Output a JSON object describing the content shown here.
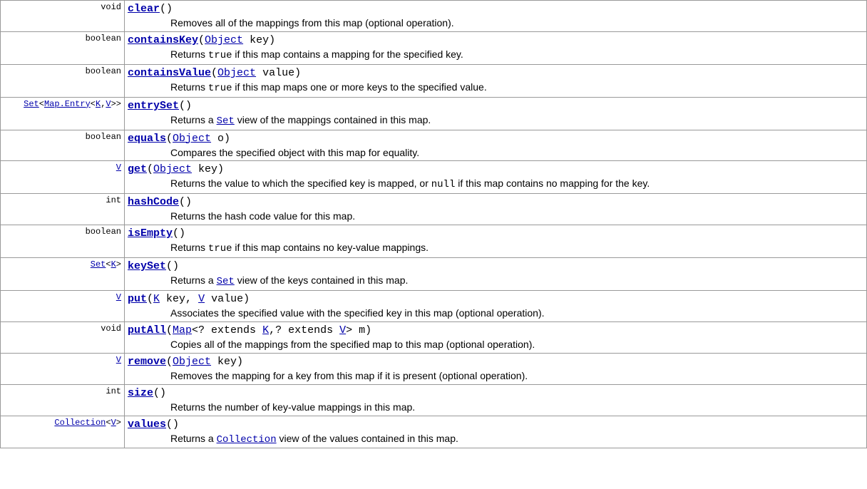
{
  "methods": [
    {
      "returnType": {
        "parts": [
          {
            "t": "void",
            "link": false
          }
        ]
      },
      "name": "clear",
      "sig": [
        {
          "t": "()",
          "link": false
        }
      ],
      "desc": [
        {
          "t": "Removes all of the mappings from this map (optional operation)."
        }
      ]
    },
    {
      "returnType": {
        "parts": [
          {
            "t": "boolean",
            "link": false
          }
        ]
      },
      "name": "containsKey",
      "sig": [
        {
          "t": "(",
          "link": false
        },
        {
          "t": "Object",
          "link": true
        },
        {
          "t": " key)",
          "link": false
        }
      ],
      "desc": [
        {
          "t": "Returns "
        },
        {
          "t": "true",
          "code": true
        },
        {
          "t": " if this map contains a mapping for the specified key."
        }
      ]
    },
    {
      "returnType": {
        "parts": [
          {
            "t": "boolean",
            "link": false
          }
        ]
      },
      "name": "containsValue",
      "sig": [
        {
          "t": "(",
          "link": false
        },
        {
          "t": "Object",
          "link": true
        },
        {
          "t": " value)",
          "link": false
        }
      ],
      "desc": [
        {
          "t": "Returns "
        },
        {
          "t": "true",
          "code": true
        },
        {
          "t": " if this map maps one or more keys to the specified value."
        }
      ]
    },
    {
      "returnType": {
        "parts": [
          {
            "t": "Set",
            "link": true
          },
          {
            "t": "<",
            "link": false
          },
          {
            "t": "Map.Entry",
            "link": true
          },
          {
            "t": "<",
            "link": false
          },
          {
            "t": "K",
            "link": true
          },
          {
            "t": ",",
            "link": false
          },
          {
            "t": "V",
            "link": true
          },
          {
            "t": ">>",
            "link": false
          }
        ]
      },
      "name": "entrySet",
      "sig": [
        {
          "t": "()",
          "link": false
        }
      ],
      "desc": [
        {
          "t": "Returns a "
        },
        {
          "t": "Set",
          "codeLink": true
        },
        {
          "t": " view of the mappings contained in this map."
        }
      ]
    },
    {
      "returnType": {
        "parts": [
          {
            "t": "boolean",
            "link": false
          }
        ]
      },
      "name": "equals",
      "sig": [
        {
          "t": "(",
          "link": false
        },
        {
          "t": "Object",
          "link": true
        },
        {
          "t": " o)",
          "link": false
        }
      ],
      "desc": [
        {
          "t": "Compares the specified object with this map for equality."
        }
      ]
    },
    {
      "returnType": {
        "parts": [
          {
            "t": "V",
            "link": true
          }
        ]
      },
      "name": "get",
      "sig": [
        {
          "t": "(",
          "link": false
        },
        {
          "t": "Object",
          "link": true
        },
        {
          "t": " key)",
          "link": false
        }
      ],
      "desc": [
        {
          "t": "Returns the value to which the specified key is mapped, or "
        },
        {
          "t": "null",
          "code": true
        },
        {
          "t": " if this map contains no mapping for the key."
        }
      ]
    },
    {
      "returnType": {
        "parts": [
          {
            "t": "int",
            "link": false
          }
        ]
      },
      "name": "hashCode",
      "sig": [
        {
          "t": "()",
          "link": false
        }
      ],
      "desc": [
        {
          "t": "Returns the hash code value for this map."
        }
      ]
    },
    {
      "returnType": {
        "parts": [
          {
            "t": "boolean",
            "link": false
          }
        ]
      },
      "name": "isEmpty",
      "sig": [
        {
          "t": "()",
          "link": false
        }
      ],
      "desc": [
        {
          "t": "Returns "
        },
        {
          "t": "true",
          "code": true
        },
        {
          "t": " if this map contains no key-value mappings."
        }
      ]
    },
    {
      "returnType": {
        "parts": [
          {
            "t": "Set",
            "link": true
          },
          {
            "t": "<",
            "link": false
          },
          {
            "t": "K",
            "link": true
          },
          {
            "t": ">",
            "link": false
          }
        ]
      },
      "name": "keySet",
      "sig": [
        {
          "t": "()",
          "link": false
        }
      ],
      "desc": [
        {
          "t": "Returns a "
        },
        {
          "t": "Set",
          "codeLink": true
        },
        {
          "t": " view of the keys contained in this map."
        }
      ]
    },
    {
      "returnType": {
        "parts": [
          {
            "t": "V",
            "link": true
          }
        ]
      },
      "name": "put",
      "sig": [
        {
          "t": "(",
          "link": false
        },
        {
          "t": "K",
          "link": true
        },
        {
          "t": " key, ",
          "link": false
        },
        {
          "t": "V",
          "link": true
        },
        {
          "t": " value)",
          "link": false
        }
      ],
      "desc": [
        {
          "t": "Associates the specified value with the specified key in this map (optional operation)."
        }
      ]
    },
    {
      "returnType": {
        "parts": [
          {
            "t": "void",
            "link": false
          }
        ]
      },
      "name": "putAll",
      "sig": [
        {
          "t": "(",
          "link": false
        },
        {
          "t": "Map",
          "link": true
        },
        {
          "t": "<? extends ",
          "link": false
        },
        {
          "t": "K",
          "link": true
        },
        {
          "t": ",? extends ",
          "link": false
        },
        {
          "t": "V",
          "link": true
        },
        {
          "t": "> m)",
          "link": false
        }
      ],
      "desc": [
        {
          "t": "Copies all of the mappings from the specified map to this map (optional operation)."
        }
      ]
    },
    {
      "returnType": {
        "parts": [
          {
            "t": "V",
            "link": true
          }
        ]
      },
      "name": "remove",
      "sig": [
        {
          "t": "(",
          "link": false
        },
        {
          "t": "Object",
          "link": true
        },
        {
          "t": " key)",
          "link": false
        }
      ],
      "desc": [
        {
          "t": "Removes the mapping for a key from this map if it is present (optional operation)."
        }
      ]
    },
    {
      "returnType": {
        "parts": [
          {
            "t": "int",
            "link": false
          }
        ]
      },
      "name": "size",
      "sig": [
        {
          "t": "()",
          "link": false
        }
      ],
      "desc": [
        {
          "t": "Returns the number of key-value mappings in this map."
        }
      ]
    },
    {
      "returnType": {
        "parts": [
          {
            "t": "Collection",
            "link": true
          },
          {
            "t": "<",
            "link": false
          },
          {
            "t": "V",
            "link": true
          },
          {
            "t": ">",
            "link": false
          }
        ]
      },
      "name": "values",
      "sig": [
        {
          "t": "()",
          "link": false
        }
      ],
      "desc": [
        {
          "t": "Returns a "
        },
        {
          "t": "Collection",
          "codeLink": true
        },
        {
          "t": " view of the values contained in this map."
        }
      ]
    }
  ]
}
